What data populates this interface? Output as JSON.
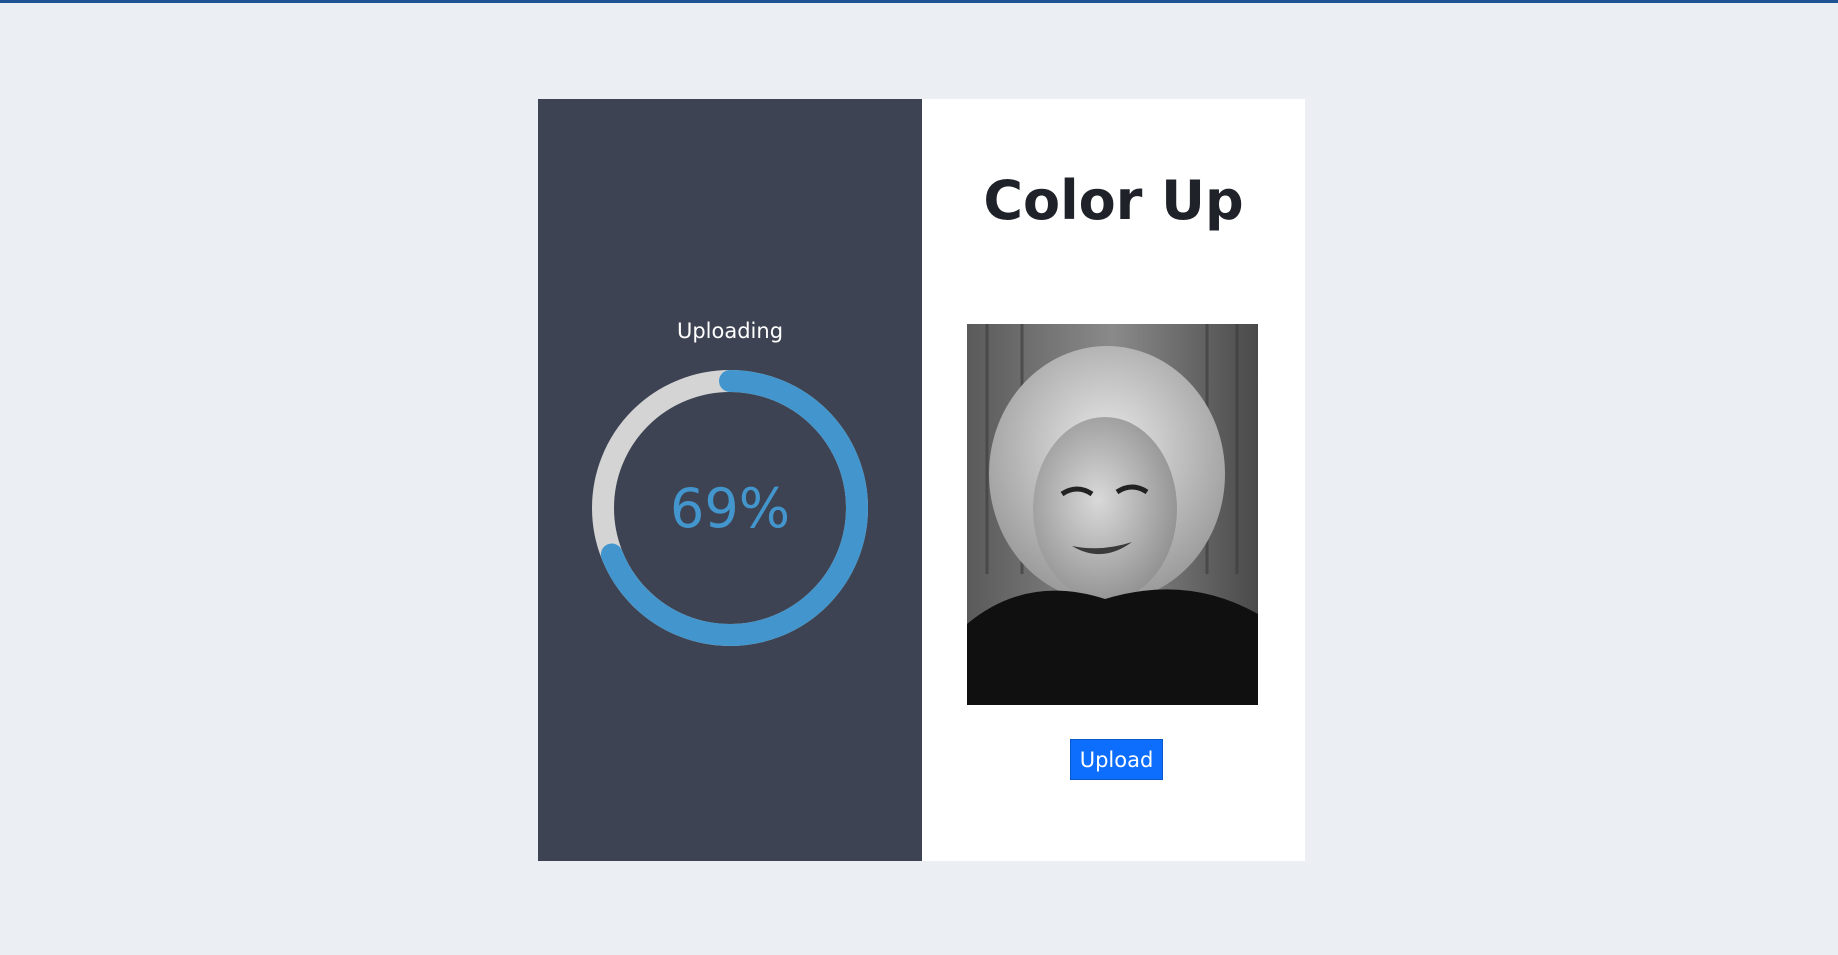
{
  "app": {
    "title": "Color Up"
  },
  "upload_status": {
    "label": "Uploading",
    "progress_percent": 69,
    "progress_text": "69%",
    "colors": {
      "progress": "#4396cd",
      "track": "#d4d4d4",
      "panel": "#3d4352"
    }
  },
  "preview": {
    "image_alt": "black-and-white portrait photo"
  },
  "actions": {
    "upload_label": "Upload",
    "button_color": "#0d6efd"
  }
}
